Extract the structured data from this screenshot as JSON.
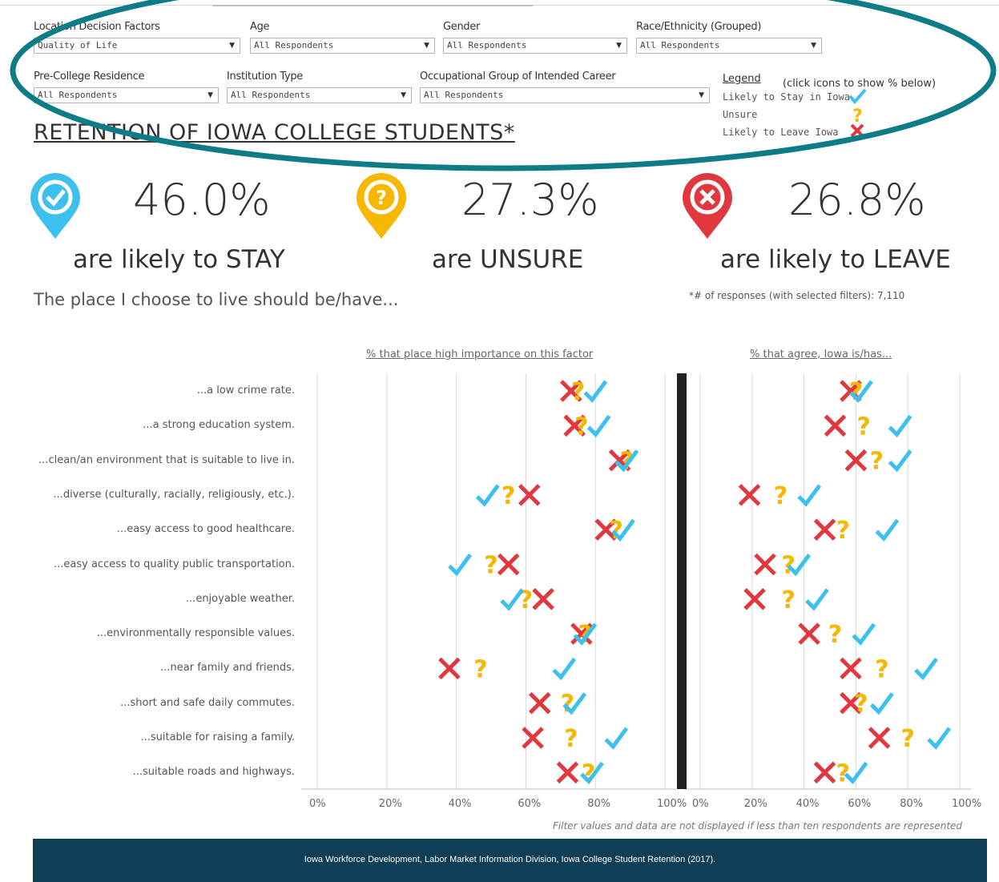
{
  "filters": {
    "row1": [
      {
        "label": "Location Decision Factors",
        "value": "Quality of Life"
      },
      {
        "label": "Age",
        "value": "All Respondents"
      },
      {
        "label": "Gender",
        "value": "All Respondents"
      },
      {
        "label": "Race/Ethnicity (Grouped)",
        "value": "All Respondents"
      }
    ],
    "row2": [
      {
        "label": "Pre-College Residence",
        "value": "All Respondents"
      },
      {
        "label": "Institution Type",
        "value": "All Respondents"
      },
      {
        "label": "Occupational Group of Intended Career",
        "value": "All Respondents"
      }
    ]
  },
  "legend": {
    "title": "Legend",
    "note": "(click icons to show % below)",
    "items": [
      {
        "label": "Likely to Stay in Iowa",
        "color": "#3ec0ef",
        "icon": "check-icon"
      },
      {
        "label": "Unsure",
        "color": "#f6b700",
        "icon": "question-icon"
      },
      {
        "label": "Likely to Leave Iowa",
        "color": "#e0383e",
        "icon": "x-icon"
      }
    ]
  },
  "title": "RETENTION OF IOWA COLLEGE STUDENTS*",
  "summary": [
    {
      "pct": "46.0%",
      "caption": "are likely to STAY",
      "color": "#3ec0ef",
      "icon": "check-pin-icon"
    },
    {
      "pct": "27.3%",
      "caption": "are UNSURE",
      "color": "#f6b700",
      "icon": "question-pin-icon"
    },
    {
      "pct": "26.8%",
      "caption": "are likely to LEAVE",
      "color": "#e0383e",
      "icon": "x-pin-icon"
    }
  ],
  "subtitle": "The place I choose to live should be/have...",
  "responses_note": "*# of responses (with selected filters): 7,110",
  "annotation_color": "#0e7c86",
  "chart_data": [
    {
      "type": "scatter",
      "title": "% that place high importance on this factor",
      "categories": [
        "...a low crime rate.",
        "...a strong education system.",
        "...clean/an environment that is suitable to live in.",
        "...diverse (culturally, racially, religiously, etc.).",
        "...easy access to good healthcare.",
        "...easy access to quality public transportation.",
        "...enjoyable weather.",
        "...environmentally responsible values.",
        "...near family and friends.",
        "...short and safe daily commutes.",
        "...suitable for raising a family.",
        "...suitable roads and highways."
      ],
      "xlim": [
        0,
        100
      ],
      "x_ticks": [
        "0%",
        "20%",
        "40%",
        "60%",
        "80%",
        "100%"
      ],
      "grid": true,
      "series": [
        {
          "name": "Likely to Stay in Iowa",
          "values": [
            80,
            81,
            89,
            49,
            88,
            41,
            56,
            77,
            71,
            74,
            86,
            79
          ]
        },
        {
          "name": "Unsure",
          "values": [
            75,
            76,
            89,
            55,
            86,
            50,
            60,
            77,
            47,
            72,
            73,
            78
          ]
        },
        {
          "name": "Likely to Leave Iowa",
          "values": [
            73,
            74,
            87,
            61,
            83,
            55,
            65,
            76,
            38,
            64,
            62,
            72
          ]
        }
      ]
    },
    {
      "type": "scatter",
      "title": "% that agree, Iowa is/has...",
      "categories": [
        "...a low crime rate.",
        "...a strong education system.",
        "...clean/an environment that is suitable to live in.",
        "...diverse (culturally, racially, religiously, etc.).",
        "...easy access to good healthcare.",
        "...easy access to quality public transportation.",
        "...enjoyable weather.",
        "...environmentally responsible values.",
        "...near family and friends.",
        "...short and safe daily commutes.",
        "...suitable for raising a family.",
        "...suitable roads and highways."
      ],
      "xlim": [
        0,
        100
      ],
      "x_ticks": [
        "0%",
        "20%",
        "40%",
        "60%",
        "80%",
        "100%"
      ],
      "grid": true,
      "series": [
        {
          "name": "Likely to Stay in Iowa",
          "values": [
            62,
            77,
            77,
            42,
            72,
            38,
            45,
            63,
            87,
            70,
            92,
            60
          ]
        },
        {
          "name": "Unsure",
          "values": [
            60,
            63,
            68,
            31,
            55,
            34,
            34,
            52,
            70,
            62,
            80,
            55
          ]
        },
        {
          "name": "Likely to Leave Iowa",
          "values": [
            58,
            52,
            60,
            19,
            48,
            25,
            21,
            42,
            58,
            58,
            69,
            48
          ]
        }
      ]
    }
  ],
  "disclaimer": "Filter values and data are not displayed if less than ten respondents are represented",
  "footer": "Iowa Workforce Development, Labor Market Information Division, Iowa College Student Retention (2017)."
}
